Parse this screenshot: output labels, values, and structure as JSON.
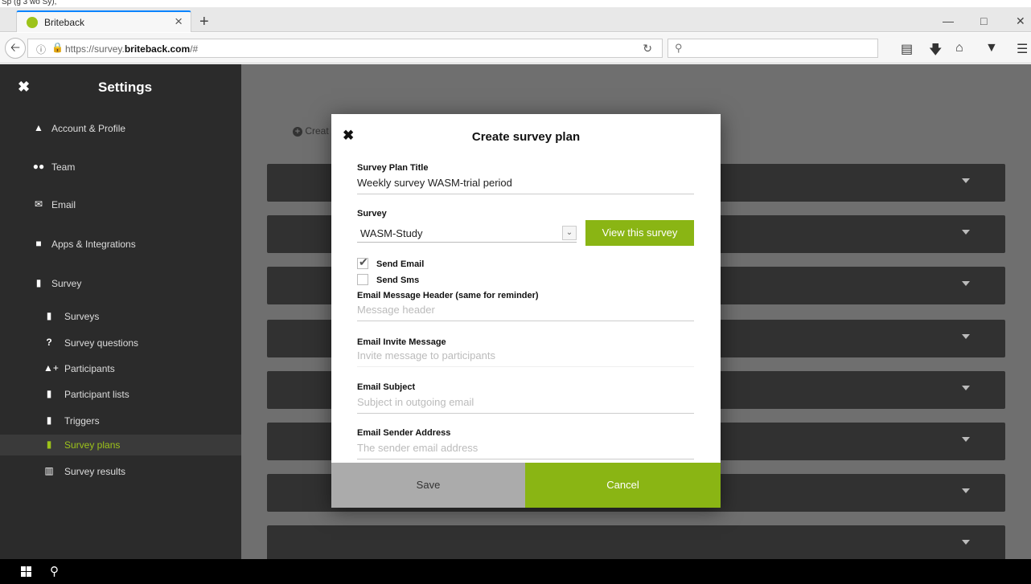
{
  "top_sliver": "Sp (g 3 wo Sy),",
  "browser": {
    "tab_title": "Briteback",
    "tab_close": "×",
    "new_tab": "+",
    "window_controls": [
      "—",
      "□",
      "✕"
    ],
    "url_prefix": "https://survey.",
    "url_domain": "briteback.com",
    "url_suffix": "/#",
    "search_icon": "search-icon",
    "toolbar_icons": [
      "clipboard-icon",
      "download-icon",
      "home-icon",
      "pocket-icon",
      "menu-icon"
    ]
  },
  "sidebar": {
    "title": "Settings",
    "items": [
      {
        "label": "Account & Profile",
        "icon": "user-icon"
      },
      {
        "label": "Team",
        "icon": "team-icon"
      },
      {
        "label": "Email",
        "icon": "envelope-icon"
      },
      {
        "label": "Apps & Integrations",
        "icon": "square-icon"
      },
      {
        "label": "Survey",
        "icon": "file-icon"
      }
    ],
    "sub_items": [
      {
        "label": "Surveys",
        "icon": "file-icon"
      },
      {
        "label": "Survey questions",
        "icon": "question-icon"
      },
      {
        "label": "Participants",
        "icon": "user-plus-icon"
      },
      {
        "label": "Participant lists",
        "icon": "file-icon"
      },
      {
        "label": "Triggers",
        "icon": "file-icon"
      },
      {
        "label": "Survey plans",
        "icon": "file-icon",
        "active": true
      },
      {
        "label": "Survey results",
        "icon": "bar-chart-icon"
      }
    ]
  },
  "content": {
    "create_link": "Creat"
  },
  "modal": {
    "title": "Create survey plan",
    "plan_title_label": "Survey Plan Title",
    "plan_title_value": "Weekly survey WASM-trial period",
    "survey_label": "Survey",
    "survey_value": "WASM-Study",
    "view_survey_button": "View this survey",
    "send_email_label": "Send Email",
    "send_email_checked": true,
    "send_sms_label": "Send Sms",
    "send_sms_checked": false,
    "email_header_label": "Email Message Header (same for reminder)",
    "email_header_placeholder": "Message header",
    "invite_label": "Email Invite Message",
    "invite_placeholder": "Invite message to participants",
    "subject_label": "Email Subject",
    "subject_placeholder": "Subject in outgoing email",
    "sender_label": "Email Sender Address",
    "sender_placeholder": "The sender email address",
    "save_button": "Save",
    "cancel_button": "Cancel"
  },
  "colors": {
    "accent": "#8ab514",
    "sidebar_bg": "#2b2b2b",
    "row_bg": "#313131",
    "overlay_bg": "#6f6f6f"
  }
}
